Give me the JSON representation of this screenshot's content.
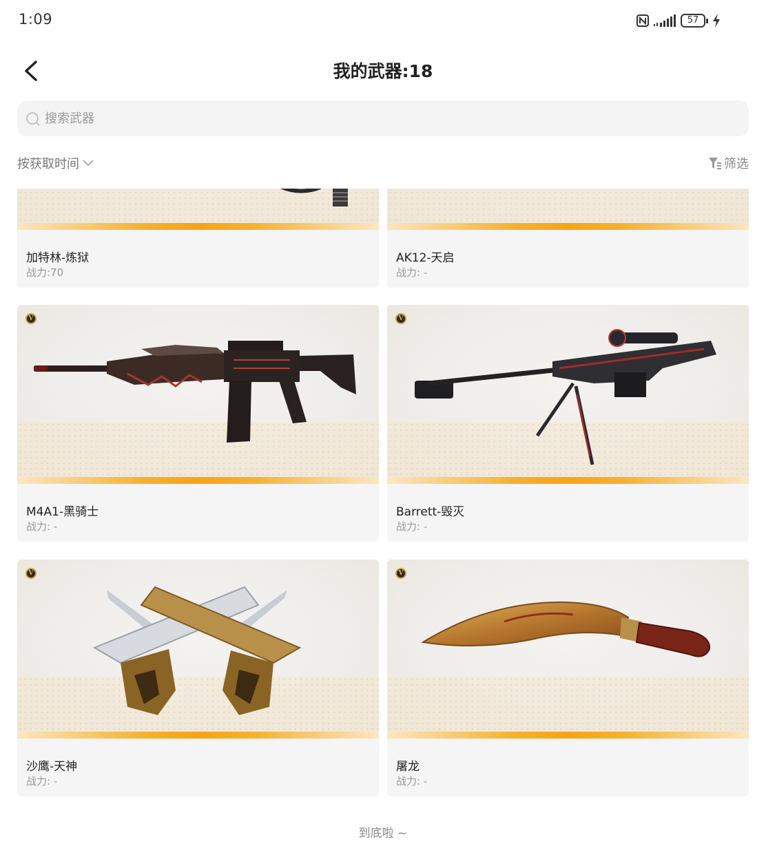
{
  "status_bar": {
    "time": "1:09",
    "battery": "57"
  },
  "header": {
    "title": "我的武器:18"
  },
  "search": {
    "placeholder": "搜索武器"
  },
  "toolbar": {
    "sort_label": "按获取时间",
    "filter_label": "筛选"
  },
  "weapons": [
    {
      "name": "加特林-炼狱",
      "power": "战力:70"
    },
    {
      "name": "AK12-天启",
      "power": "战力: -"
    },
    {
      "name": "M4A1-黑骑士",
      "power": "战力: -"
    },
    {
      "name": "Barrett-毁灭",
      "power": "战力: -"
    },
    {
      "name": "沙鹰-天神",
      "power": "战力: -"
    },
    {
      "name": "屠龙",
      "power": "战力: -"
    }
  ],
  "footer": {
    "end_text": "到底啦 ~"
  },
  "colors": {
    "rarity_gold": "#f6a416",
    "card_bg": "#f5f5f5",
    "search_bg": "#f4f4f4"
  }
}
